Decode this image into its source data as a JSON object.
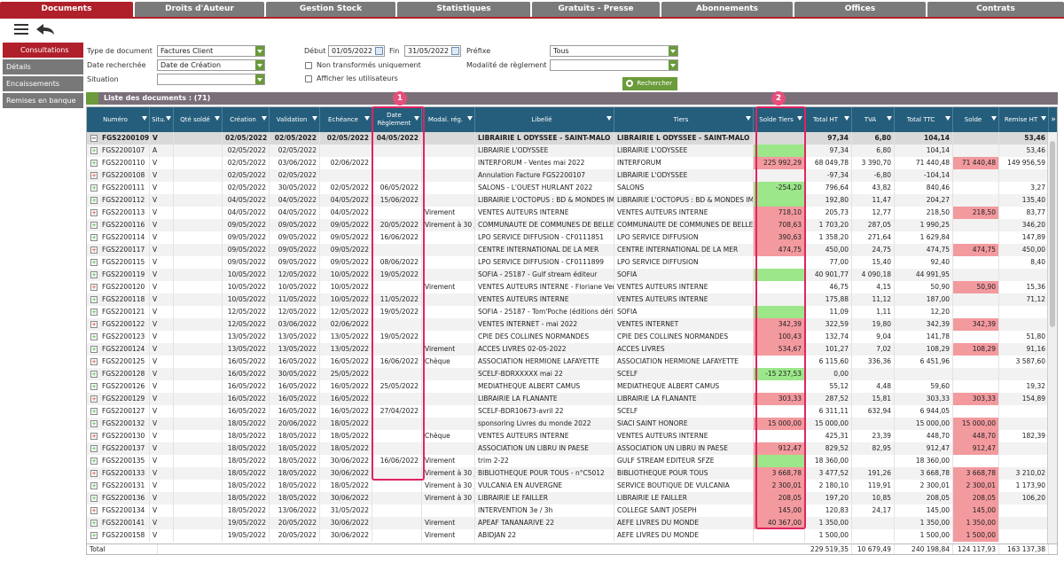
{
  "nav_tabs": [
    "Documents",
    "Droits d'Auteur",
    "Gestion Stock",
    "Statistiques",
    "Gratuits - Presse",
    "Abonnements",
    "Offices",
    "Contrats"
  ],
  "sidebar": [
    "Consultations",
    "Détails",
    "Encaissements",
    "Remises en banque"
  ],
  "filters": {
    "type_label": "Type de document",
    "type_value": "Factures Client",
    "date_label": "Date recherchée",
    "date_value": "Date de Création",
    "situation_label": "Situation",
    "situation_value": "",
    "debut_label": "Début",
    "debut_value": "01/05/2022",
    "fin_label": "Fin",
    "fin_value": "31/05/2022",
    "non_transformes": "Non transformés uniquement",
    "afficher_utilisateurs": "Afficher les utilisateurs",
    "prefixe_label": "Préfixe",
    "prefixe_value": "Tous",
    "modalite_label": "Modalité de règlement",
    "modalite_value": "",
    "search_button": "Rechercher"
  },
  "list_title": "Liste des documents : (71)",
  "columns": [
    "Numéro",
    "Situ.",
    "Qté soldé",
    "Création",
    "Validation",
    "Echéance",
    "Date Règlement",
    "Modal. rég.",
    "Libellé",
    "Tiers",
    "Solde Tiers",
    "Total HT",
    "TVA",
    "Total TTC",
    "Solde",
    "Remise HT"
  ],
  "rows": [
    {
      "num": "FGS2200109",
      "situ": "V",
      "qte": "",
      "creation": "02/05/2022",
      "validation": "02/05/2022",
      "echeance": "02/05/2022",
      "reglement": "04/05/2022",
      "modal": "",
      "libelle": "LIBRAIRIE L ODYSSEE - SAINT-MALO",
      "tiers": "LIBRAIRIE L ODYSSEE - SAINT-MALO",
      "solde_tiers": "",
      "ht": "97,34",
      "tva": "6,80",
      "ttc": "104,14",
      "solde": "",
      "remise": "53,46",
      "st": "",
      "sc": "",
      "bold": true
    },
    {
      "num": "FGS2200107",
      "situ": "A",
      "qte": "",
      "creation": "02/05/2022",
      "validation": "02/05/2022",
      "echeance": "",
      "reglement": "",
      "modal": "",
      "libelle": "LIBRAIRIE L'ODYSSEE",
      "tiers": "LIBRAIRIE L'ODYSSEE",
      "solde_tiers": "",
      "ht": "97,34",
      "tva": "6,80",
      "ttc": "104,14",
      "solde": "",
      "remise": "53,46",
      "st": "green",
      "sc": ""
    },
    {
      "num": "FGS2200110",
      "situ": "V",
      "qte": "",
      "creation": "02/05/2022",
      "validation": "03/06/2022",
      "echeance": "02/06/2022",
      "reglement": "",
      "modal": "",
      "libelle": "INTERFORUM - Ventes mai 2022",
      "tiers": "INTERFORUM",
      "solde_tiers": "225 992,29",
      "ht": "68 049,78",
      "tva": "3 390,70",
      "ttc": "71 440,48",
      "solde": "71 440,48",
      "remise": "149 956,59",
      "st": "red",
      "sc": "red"
    },
    {
      "num": "FGS2200108",
      "situ": "V",
      "qte": "",
      "creation": "02/05/2022",
      "validation": "02/05/2022",
      "echeance": "",
      "reglement": "",
      "modal": "",
      "libelle": "Annulation Facture FGS2200107",
      "tiers": "LIBRAIRIE L'ODYSSEE",
      "solde_tiers": "",
      "ht": "-97,34",
      "tva": "-6,80",
      "ttc": "-104,14",
      "solde": "",
      "remise": "",
      "st": "",
      "sc": ""
    },
    {
      "num": "FGS2200111",
      "situ": "V",
      "qte": "",
      "creation": "02/05/2022",
      "validation": "30/05/2022",
      "echeance": "02/05/2022",
      "reglement": "06/05/2022",
      "modal": "",
      "libelle": "SALONS - L'OUEST HURLANT 2022",
      "tiers": "SALONS",
      "solde_tiers": "-254,20",
      "ht": "796,64",
      "tva": "43,82",
      "ttc": "840,46",
      "solde": "",
      "remise": "3,27",
      "st": "green",
      "sc": ""
    },
    {
      "num": "FGS2200112",
      "situ": "V",
      "qte": "",
      "creation": "04/05/2022",
      "validation": "04/05/2022",
      "echeance": "04/05/2022",
      "reglement": "15/06/2022",
      "modal": "",
      "libelle": "LIBRAIRIE L'OCTOPUS : BD & MONDES IMAG",
      "tiers": "LIBRAIRIE L'OCTOPUS : BD & MONDES IMAG",
      "solde_tiers": "",
      "ht": "192,80",
      "tva": "11,47",
      "ttc": "204,27",
      "solde": "",
      "remise": "135,40",
      "st": "green",
      "sc": ""
    },
    {
      "num": "FGS2200113",
      "situ": "V",
      "qte": "",
      "creation": "04/05/2022",
      "validation": "04/05/2022",
      "echeance": "04/05/2022",
      "reglement": "",
      "modal": "Virement",
      "libelle": "VENTES AUTEURS INTERNE",
      "tiers": "VENTES AUTEURS INTERNE",
      "solde_tiers": "718,10",
      "ht": "205,73",
      "tva": "12,77",
      "ttc": "218,50",
      "solde": "218,50",
      "remise": "83,77",
      "st": "red",
      "sc": "red"
    },
    {
      "num": "FGS2200116",
      "situ": "V",
      "qte": "",
      "creation": "09/05/2022",
      "validation": "09/05/2022",
      "echeance": "09/05/2022",
      "reglement": "20/05/2022",
      "modal": "Virement à 30 j",
      "libelle": "COMMUNAUTE DE COMMUNES DE BELLE IL",
      "tiers": "COMMUNAUTE DE COMMUNES DE BELLE IL",
      "solde_tiers": "708,63",
      "ht": "1 703,20",
      "tva": "287,05",
      "ttc": "1 990,25",
      "solde": "",
      "remise": "346,20",
      "st": "red",
      "sc": ""
    },
    {
      "num": "FGS2200114",
      "situ": "V",
      "qte": "",
      "creation": "09/05/2022",
      "validation": "09/05/2022",
      "echeance": "09/05/2022",
      "reglement": "16/06/2022",
      "modal": "",
      "libelle": "LPO SERVICE DIFFUSION - CF0111851",
      "tiers": "LPO SERVICE DIFFUSION",
      "solde_tiers": "390,63",
      "ht": "1 358,20",
      "tva": "271,64",
      "ttc": "1 629,84",
      "solde": "",
      "remise": "147,89",
      "st": "red",
      "sc": ""
    },
    {
      "num": "FGS2200117",
      "situ": "V",
      "qte": "",
      "creation": "09/05/2022",
      "validation": "09/05/2022",
      "echeance": "09/05/2022",
      "reglement": "",
      "modal": "",
      "libelle": "CENTRE INTERNATIONAL DE LA MER",
      "tiers": "CENTRE INTERNATIONAL DE LA MER",
      "solde_tiers": "474,75",
      "ht": "450,00",
      "tva": "24,75",
      "ttc": "474,75",
      "solde": "474,75",
      "remise": "450,00",
      "st": "red",
      "sc": "red"
    },
    {
      "num": "FGS2200115",
      "situ": "V",
      "qte": "",
      "creation": "09/05/2022",
      "validation": "09/05/2022",
      "echeance": "09/05/2022",
      "reglement": "08/06/2022",
      "modal": "",
      "libelle": "LPO SERVICE DIFFUSION - CF0111899",
      "tiers": "LPO SERVICE DIFFUSION",
      "solde_tiers": "",
      "ht": "77,00",
      "tva": "15,40",
      "ttc": "92,40",
      "solde": "",
      "remise": "8,40",
      "st": "",
      "sc": ""
    },
    {
      "num": "FGS2200119",
      "situ": "V",
      "qte": "",
      "creation": "10/05/2022",
      "validation": "12/05/2022",
      "echeance": "10/05/2022",
      "reglement": "19/05/2022",
      "modal": "",
      "libelle": "SOFIA - 25187 - Gulf stream éditeur",
      "tiers": "SOFIA",
      "solde_tiers": "",
      "ht": "40 901,77",
      "tva": "4 090,18",
      "ttc": "44 991,95",
      "solde": "",
      "remise": "",
      "st": "green",
      "sc": ""
    },
    {
      "num": "FGS2200120",
      "situ": "V",
      "qte": "",
      "creation": "10/05/2022",
      "validation": "10/05/2022",
      "echeance": "10/05/2022",
      "reglement": "",
      "modal": "Virement",
      "libelle": "VENTES AUTEURS INTERNE - Floriane Verh",
      "tiers": "VENTES AUTEURS INTERNE",
      "solde_tiers": "",
      "ht": "46,75",
      "tva": "4,15",
      "ttc": "50,90",
      "solde": "50,90",
      "remise": "15,36",
      "st": "",
      "sc": "red"
    },
    {
      "num": "FGS2200118",
      "situ": "V",
      "qte": "",
      "creation": "10/05/2022",
      "validation": "11/05/2022",
      "echeance": "10/05/2022",
      "reglement": "11/05/2022",
      "modal": "",
      "libelle": "VENTES AUTEURS INTERNE",
      "tiers": "VENTES AUTEURS INTERNE",
      "solde_tiers": "",
      "ht": "175,88",
      "tva": "11,12",
      "ttc": "187,00",
      "solde": "",
      "remise": "71,12",
      "st": "",
      "sc": ""
    },
    {
      "num": "FGS2200121",
      "situ": "V",
      "qte": "",
      "creation": "12/05/2022",
      "validation": "12/05/2022",
      "echeance": "12/05/2022",
      "reglement": "19/05/2022",
      "modal": "",
      "libelle": "SOFIA - 25187 - Tom'Poche (éditions dérivé",
      "tiers": "SOFIA",
      "solde_tiers": "",
      "ht": "11,09",
      "tva": "1,11",
      "ttc": "12,20",
      "solde": "",
      "remise": "",
      "st": "green",
      "sc": ""
    },
    {
      "num": "FGS2200122",
      "situ": "V",
      "qte": "",
      "creation": "12/05/2022",
      "validation": "03/06/2022",
      "echeance": "02/06/2022",
      "reglement": "",
      "modal": "",
      "libelle": "VENTES INTERNET - mai 2022",
      "tiers": "VENTES INTERNET",
      "solde_tiers": "342,39",
      "ht": "322,59",
      "tva": "19,80",
      "ttc": "342,39",
      "solde": "342,39",
      "remise": "",
      "st": "red",
      "sc": "red"
    },
    {
      "num": "FGS2200123",
      "situ": "V",
      "qte": "",
      "creation": "13/05/2022",
      "validation": "13/05/2022",
      "echeance": "13/05/2022",
      "reglement": "19/05/2022",
      "modal": "",
      "libelle": "CPIE DES COLLINES NORMANDES",
      "tiers": "CPIE DES COLLINES NORMANDES",
      "solde_tiers": "100,43",
      "ht": "132,74",
      "tva": "9,04",
      "ttc": "141,78",
      "solde": "",
      "remise": "51,80",
      "st": "red",
      "sc": ""
    },
    {
      "num": "FGS2200124",
      "situ": "V",
      "qte": "",
      "creation": "13/05/2022",
      "validation": "13/05/2022",
      "echeance": "13/05/2022",
      "reglement": "",
      "modal": "Virement",
      "libelle": "ACCES LIVRES 02-05-2022",
      "tiers": "ACCES LIVRES",
      "solde_tiers": "534,67",
      "ht": "101,27",
      "tva": "7,02",
      "ttc": "108,29",
      "solde": "108,29",
      "remise": "91,16",
      "st": "red",
      "sc": "red"
    },
    {
      "num": "FGS2200125",
      "situ": "V",
      "qte": "",
      "creation": "16/05/2022",
      "validation": "16/05/2022",
      "echeance": "16/05/2022",
      "reglement": "16/06/2022",
      "modal": "Chèque",
      "libelle": "ASSOCIATION HERMIONE LAFAYETTE",
      "tiers": "ASSOCIATION HERMIONE LAFAYETTE",
      "solde_tiers": "",
      "ht": "6 115,60",
      "tva": "336,36",
      "ttc": "6 451,96",
      "solde": "",
      "remise": "3 587,60",
      "st": "",
      "sc": ""
    },
    {
      "num": "FGS2200128",
      "situ": "V",
      "qte": "",
      "creation": "16/05/2022",
      "validation": "30/05/2022",
      "echeance": "25/05/2022",
      "reglement": "",
      "modal": "",
      "libelle": "SCELF-BDRXXXXX mai 22",
      "tiers": "SCELF",
      "solde_tiers": "-15 237,53",
      "ht": "0,00",
      "tva": "",
      "ttc": "",
      "solde": "",
      "remise": "",
      "st": "green",
      "sc": ""
    },
    {
      "num": "FGS2200126",
      "situ": "V",
      "qte": "",
      "creation": "16/05/2022",
      "validation": "16/05/2022",
      "echeance": "16/05/2022",
      "reglement": "25/05/2022",
      "modal": "",
      "libelle": "MEDIATHEQUE ALBERT CAMUS",
      "tiers": "MEDIATHEQUE ALBERT CAMUS",
      "solde_tiers": "",
      "ht": "55,12",
      "tva": "4,48",
      "ttc": "59,60",
      "solde": "",
      "remise": "19,32",
      "st": "",
      "sc": ""
    },
    {
      "num": "FGS2200129",
      "situ": "V",
      "qte": "",
      "creation": "16/05/2022",
      "validation": "16/05/2022",
      "echeance": "16/05/2022",
      "reglement": "",
      "modal": "",
      "libelle": "LIBRAIRIE LA FLANANTE",
      "tiers": "LIBRAIRIE LA FLANANTE",
      "solde_tiers": "303,33",
      "ht": "287,52",
      "tva": "15,81",
      "ttc": "303,33",
      "solde": "303,33",
      "remise": "154,89",
      "st": "red",
      "sc": "red"
    },
    {
      "num": "FGS2200127",
      "situ": "V",
      "qte": "",
      "creation": "16/05/2022",
      "validation": "16/05/2022",
      "echeance": "16/05/2022",
      "reglement": "27/04/2022",
      "modal": "",
      "libelle": "SCELF-BDR10673-avril 22",
      "tiers": "SCELF",
      "solde_tiers": "",
      "ht": "6 311,11",
      "tva": "632,94",
      "ttc": "6 944,05",
      "solde": "",
      "remise": "",
      "st": "",
      "sc": ""
    },
    {
      "num": "FGS2200132",
      "situ": "V",
      "qte": "",
      "creation": "18/05/2022",
      "validation": "20/06/2022",
      "echeance": "18/05/2022",
      "reglement": "",
      "modal": "",
      "libelle": "sponsoring Livres du monde 2022",
      "tiers": "SIACI SAINT HONORE",
      "solde_tiers": "15 000,00",
      "ht": "15 000,00",
      "tva": "",
      "ttc": "15 000,00",
      "solde": "15 000,00",
      "remise": "",
      "st": "red",
      "sc": "red"
    },
    {
      "num": "FGS2200130",
      "situ": "V",
      "qte": "",
      "creation": "18/05/2022",
      "validation": "18/05/2022",
      "echeance": "18/05/2022",
      "reglement": "",
      "modal": "Chèque",
      "libelle": "VENTES AUTEURS INTERNE",
      "tiers": "VENTES AUTEURS INTERNE",
      "solde_tiers": "",
      "ht": "425,31",
      "tva": "23,39",
      "ttc": "448,70",
      "solde": "448,70",
      "remise": "182,39",
      "st": "",
      "sc": "red"
    },
    {
      "num": "FGS2200137",
      "situ": "V",
      "qte": "",
      "creation": "18/05/2022",
      "validation": "18/05/2022",
      "echeance": "18/05/2022",
      "reglement": "",
      "modal": "",
      "libelle": "ASSOCIATION UN LIBRU IN PAESE",
      "tiers": "ASSOCIATION UN LIBRU IN PAESE",
      "solde_tiers": "912,47",
      "ht": "829,52",
      "tva": "82,95",
      "ttc": "912,47",
      "solde": "912,47",
      "remise": "",
      "st": "red",
      "sc": "red"
    },
    {
      "num": "FGS2200135",
      "situ": "V",
      "qte": "",
      "creation": "18/05/2022",
      "validation": "18/05/2022",
      "echeance": "30/06/2022",
      "reglement": "16/06/2022",
      "modal": "Virement",
      "libelle": "trim 2-22",
      "tiers": "GULF STREAM EDITEUR SFZE",
      "solde_tiers": "",
      "ht": "18 360,00",
      "tva": "",
      "ttc": "18 360,00",
      "solde": "",
      "remise": "",
      "st": "green",
      "sc": ""
    },
    {
      "num": "FGS2200133",
      "situ": "V",
      "qte": "",
      "creation": "18/05/2022",
      "validation": "18/05/2022",
      "echeance": "30/06/2022",
      "reglement": "",
      "modal": "Virement à 30 j",
      "libelle": "BIBLIOTHEQUE POUR TOUS - n°C5012",
      "tiers": "BIBLIOTHEQUE POUR TOUS",
      "solde_tiers": "3 668,78",
      "ht": "3 477,52",
      "tva": "191,26",
      "ttc": "3 668,78",
      "solde": "3 668,78",
      "remise": "3 210,02",
      "st": "red",
      "sc": "red"
    },
    {
      "num": "FGS2200131",
      "situ": "V",
      "qte": "",
      "creation": "18/05/2022",
      "validation": "18/05/2022",
      "echeance": "18/05/2022",
      "reglement": "",
      "modal": "Virement à 30 j",
      "libelle": "VULCANIA EN AUVERGNE",
      "tiers": "SERVICE BOUTIQUE DE VULCANIA",
      "solde_tiers": "2 300,01",
      "ht": "2 180,10",
      "tva": "119,91",
      "ttc": "2 300,01",
      "solde": "2 300,01",
      "remise": "1 173,90",
      "st": "red",
      "sc": "red"
    },
    {
      "num": "FGS2200136",
      "situ": "V",
      "qte": "",
      "creation": "18/05/2022",
      "validation": "18/05/2022",
      "echeance": "30/06/2022",
      "reglement": "",
      "modal": "Virement à 30 j",
      "libelle": "LIBRAIRIE LE FAILLER",
      "tiers": "LIBRAIRIE LE FAILLER",
      "solde_tiers": "208,05",
      "ht": "197,20",
      "tva": "10,85",
      "ttc": "208,05",
      "solde": "208,05",
      "remise": "106,20",
      "st": "red",
      "sc": "red"
    },
    {
      "num": "FGS2200134",
      "situ": "V",
      "qte": "",
      "creation": "18/05/2022",
      "validation": "13/06/2022",
      "echeance": "31/05/2022",
      "reglement": "",
      "modal": "",
      "libelle": "INTERVENTION 3e / 3h",
      "tiers": "COLLEGE SAINT JOSEPH",
      "solde_tiers": "145,00",
      "ht": "120,83",
      "tva": "24,17",
      "ttc": "145,00",
      "solde": "145,00",
      "remise": "",
      "st": "red",
      "sc": "red"
    },
    {
      "num": "FGS2200141",
      "situ": "V",
      "qte": "",
      "creation": "19/05/2022",
      "validation": "20/05/2022",
      "echeance": "30/06/2022",
      "reglement": "",
      "modal": "Virement",
      "libelle": "APEAF TANANARIVE 22",
      "tiers": "AEFE LIVRES DU MONDE",
      "solde_tiers": "40 367,00",
      "ht": "1 350,00",
      "tva": "",
      "ttc": "1 350,00",
      "solde": "1 350,00",
      "remise": "",
      "st": "red",
      "sc": "red"
    },
    {
      "num": "FGS2200158",
      "situ": "V",
      "qte": "",
      "creation": "19/05/2022",
      "validation": "20/05/2022",
      "echeance": "30/06/2022",
      "reglement": "",
      "modal": "Virement",
      "libelle": "ABIDJAN 22",
      "tiers": "AEFE LIVRES DU MONDE",
      "solde_tiers": "",
      "ht": "1 500,00",
      "tva": "",
      "ttc": "1 500,00",
      "solde": "1 500,00",
      "remise": "",
      "st": "",
      "sc": "red"
    }
  ],
  "totals": {
    "label": "Total",
    "ht": "229 519,35",
    "tva": "10 679,49",
    "ttc": "240 198,84",
    "solde": "124 117,93",
    "remise": "163 137,38"
  },
  "annotations": [
    "1",
    "2"
  ],
  "colors": {
    "accent": "#b0202a",
    "header": "#255e7c",
    "red": "#f39a9f",
    "green": "#9be78a",
    "highlight": "#e0245e"
  }
}
